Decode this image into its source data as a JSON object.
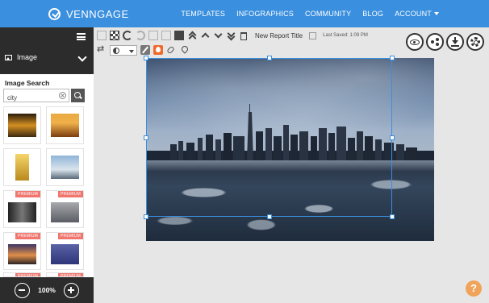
{
  "brand": {
    "name": "VENNGAGE"
  },
  "nav": {
    "items": [
      {
        "label": "TEMPLATES"
      },
      {
        "label": "INFOGRAPHICS"
      },
      {
        "label": "COMMUNITY"
      },
      {
        "label": "BLOG"
      },
      {
        "label": "ACCOUNT"
      }
    ]
  },
  "sidebar": {
    "panel_label": "Image",
    "section_title": "Image Search",
    "search": {
      "value": "city"
    },
    "premium_badge": "PREMIUM",
    "zoom": "100%"
  },
  "toolbar": {
    "document_title": "New Report Title",
    "last_saved": "Last Saved: 1:09 PM"
  },
  "help": {
    "label": "?"
  },
  "colors": {
    "nav_bg": "#3a8fde",
    "sidebar_dark": "#2c2c2c",
    "premium_badge": "#f0766e",
    "help_button": "#f0a35a",
    "fill_active": "#f26a2a"
  },
  "icons": [
    "venngage-logo-icon",
    "hamburger-icon",
    "image-icon",
    "chevron-down-icon",
    "clear-icon",
    "search-icon",
    "zoom-out-icon",
    "zoom-in-icon",
    "preview-eye-icon",
    "share-icon",
    "download-icon",
    "settings-gear-icon"
  ]
}
